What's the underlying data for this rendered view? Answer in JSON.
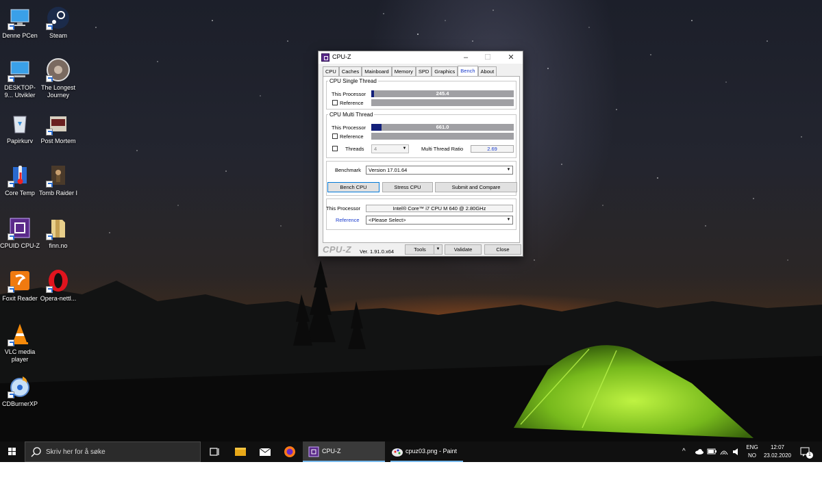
{
  "desktop_icons": [
    {
      "label": "Denne PCen",
      "icon": "computer-icon"
    },
    {
      "label": "Steam",
      "icon": "steam-icon"
    },
    {
      "label": "DESKTOP-9... Utvikler",
      "icon": "network-computer-icon"
    },
    {
      "label": "The Longest Journey",
      "icon": "game-disc-icon"
    },
    {
      "label": "Papirkurv",
      "icon": "recycle-bin-icon"
    },
    {
      "label": "Post Mortem",
      "icon": "game-icon"
    },
    {
      "label": "Core Temp",
      "icon": "thermometer-icon"
    },
    {
      "label": "Tomb Raider I",
      "icon": "game-icon"
    },
    {
      "label": "CPUID CPU-Z",
      "icon": "cpuz-icon"
    },
    {
      "label": "finn.no",
      "icon": "folder-icon"
    },
    {
      "label": "Foxit Reader",
      "icon": "pdf-icon"
    },
    {
      "label": "Opera-nettl...",
      "icon": "opera-icon"
    },
    {
      "label": "VLC media player",
      "icon": "vlc-cone-icon"
    },
    {
      "label": "CDBurnerXP",
      "icon": "disc-burn-icon"
    }
  ],
  "cpuz": {
    "title": "CPU-Z",
    "tabs": [
      "CPU",
      "Caches",
      "Mainboard",
      "Memory",
      "SPD",
      "Graphics",
      "Bench",
      "About"
    ],
    "active_tab": "Bench",
    "single": {
      "legend": "CPU Single Thread",
      "this_processor_label": "This Processor",
      "this_value": "245.4",
      "this_fill": 0.02,
      "reference_label": "Reference"
    },
    "multi": {
      "legend": "CPU Multi Thread",
      "this_processor_label": "This Processor",
      "this_value": "661.0",
      "this_fill": 0.07,
      "reference_label": "Reference",
      "threads_label": "Threads",
      "threads_value": "4",
      "ratio_label": "Multi Thread Ratio",
      "ratio_value": "2.69"
    },
    "bench": {
      "benchmark_label": "Benchmark",
      "benchmark_value": "Version 17.01.64",
      "bench_cpu": "Bench CPU",
      "stress_cpu": "Stress CPU",
      "submit": "Submit and Compare"
    },
    "info": {
      "this_processor_label": "This Processor",
      "processor_name": "Intel® Core™ i7 CPU       M 640  @ 2.80GHz",
      "reference_label": "Reference",
      "reference_value": "<Please Select>"
    },
    "footer": {
      "logo": "CPU-Z",
      "version": "Ver. 1.91.0.x64",
      "tools": "Tools",
      "validate": "Validate",
      "close": "Close"
    }
  },
  "taskbar": {
    "search_placeholder": "Skriv her for å søke",
    "apps": [
      {
        "name": "CPU-Z",
        "active": true
      },
      {
        "name": "cpuz03.png - Paint",
        "active": false
      }
    ],
    "lang_top": "ENG",
    "lang_bottom": "NO",
    "time": "12:07",
    "date": "23.02.2020",
    "notification_count": "1"
  },
  "colors": {
    "bench_fill": "#13207a",
    "bench_bar": "#a0a0a4",
    "active_tab_text": "#1a3ccd",
    "tent": "#8fd32a"
  }
}
